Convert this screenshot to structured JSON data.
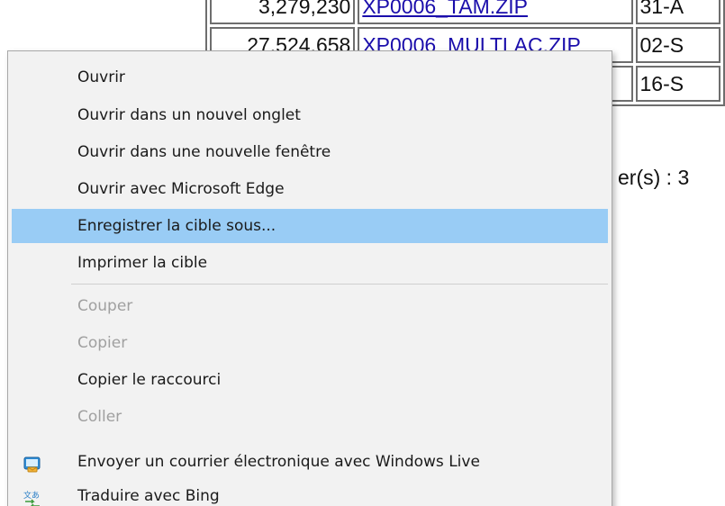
{
  "background_page": {
    "table_rows": [
      {
        "size": "3,279,230",
        "name": "XP0006_TAM.ZIP",
        "date": "31-A"
      },
      {
        "size": "27,524,658",
        "name": "XP0006_MULTLAC.ZIP",
        "date": "02-S"
      },
      {
        "size": "",
        "name": "",
        "date": "16-S"
      }
    ],
    "count_text": "er(s) : 3"
  },
  "context_menu": {
    "items": [
      {
        "label": "Ouvrir",
        "state": "enabled"
      },
      {
        "label": "Ouvrir dans un nouvel onglet",
        "state": "enabled"
      },
      {
        "label": "Ouvrir dans une nouvelle fenêtre",
        "state": "enabled"
      },
      {
        "label": "Ouvrir avec Microsoft Edge",
        "state": "enabled"
      },
      {
        "label": "Enregistrer la cible sous...",
        "state": "highlighted"
      },
      {
        "label": "Imprimer la cible",
        "state": "enabled"
      },
      {
        "label": "Couper",
        "state": "disabled"
      },
      {
        "label": "Copier",
        "state": "disabled"
      },
      {
        "label": "Copier le raccourci",
        "state": "enabled"
      },
      {
        "label": "Coller",
        "state": "disabled"
      },
      {
        "label": "Envoyer un courrier électronique avec Windows Live",
        "state": "enabled",
        "icon": "windows-live-mail-icon"
      },
      {
        "label": "Traduire avec Bing",
        "state": "enabled",
        "icon": "bing-translate-icon"
      }
    ]
  },
  "colors": {
    "highlight": "#99ccf5",
    "menu_background": "#f2f2f2",
    "disabled_text": "#a0a0a0",
    "link": "#1a0dab"
  }
}
